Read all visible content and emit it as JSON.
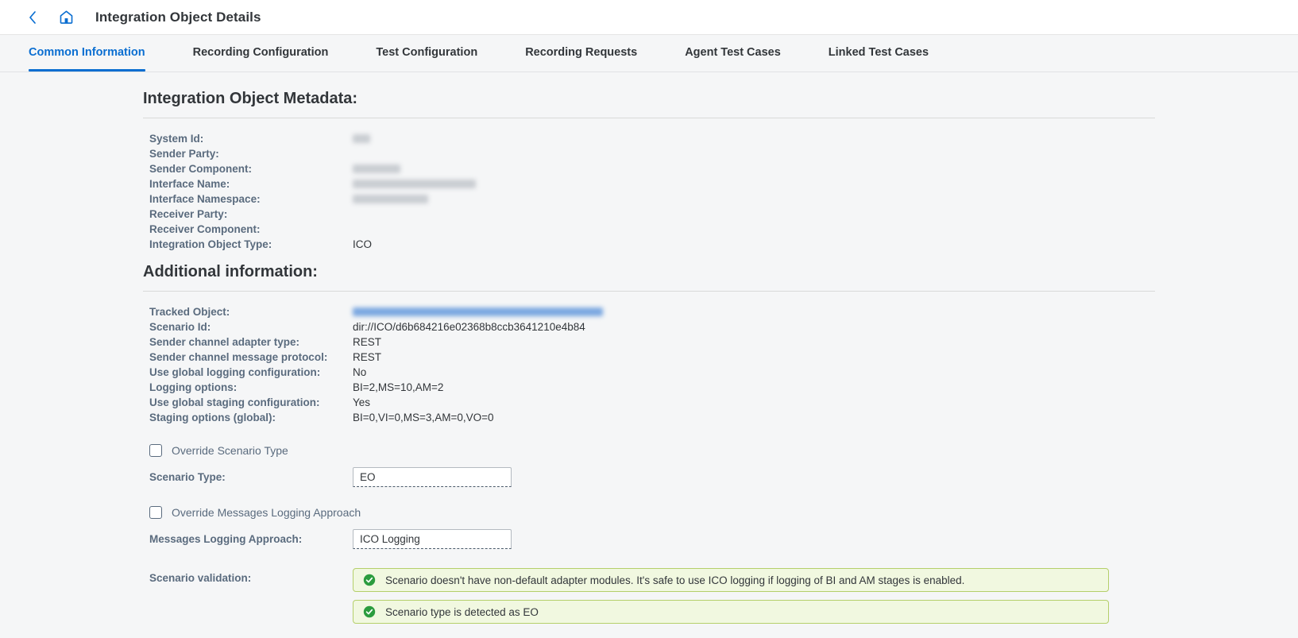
{
  "header": {
    "back_icon": "chevron-left-icon",
    "home_icon": "home-icon",
    "title": "Integration Object Details"
  },
  "tabs": [
    {
      "label": "Common Information",
      "active": true
    },
    {
      "label": "Recording Configuration",
      "active": false
    },
    {
      "label": "Test Configuration",
      "active": false
    },
    {
      "label": "Recording Requests",
      "active": false
    },
    {
      "label": "Agent Test Cases",
      "active": false
    },
    {
      "label": "Linked Test Cases",
      "active": false
    }
  ],
  "metadata": {
    "title": "Integration Object Metadata:",
    "fields": [
      {
        "label": "System Id:",
        "value": "",
        "redacted": true,
        "redact_w": 22,
        "redact_color": "gray"
      },
      {
        "label": "Sender Party:",
        "value": "",
        "redacted": false
      },
      {
        "label": "Sender Component:",
        "value": "",
        "redacted": true,
        "redact_w": 60,
        "redact_color": "gray"
      },
      {
        "label": "Interface Name:",
        "value": "",
        "redacted": true,
        "redact_w": 155,
        "redact_color": "gray"
      },
      {
        "label": "Interface Namespace:",
        "value": "",
        "redacted": true,
        "redact_w": 95,
        "redact_color": "gray"
      },
      {
        "label": "Receiver Party:",
        "value": "",
        "redacted": false
      },
      {
        "label": "Receiver Component:",
        "value": "",
        "redacted": false
      },
      {
        "label": "Integration Object Type:",
        "value": "ICO",
        "redacted": false
      }
    ]
  },
  "additional": {
    "title": "Additional information:",
    "fields": [
      {
        "label": "Tracked Object:",
        "value": "",
        "redacted": true,
        "redact_w": 315,
        "redact_color": "blue"
      },
      {
        "label": "Scenario Id:",
        "value": "dir://ICO/d6b684216e02368b8ccb3641210e4b84",
        "redacted": false
      },
      {
        "label": "Sender channel adapter type:",
        "value": "REST",
        "redacted": false
      },
      {
        "label": "Sender channel message protocol:",
        "value": "REST",
        "redacted": false
      },
      {
        "label": "Use global logging configuration:",
        "value": "No",
        "redacted": false
      },
      {
        "label": "Logging options:",
        "value": "BI=2,MS=10,AM=2",
        "redacted": false
      },
      {
        "label": "Use global staging configuration:",
        "value": "Yes",
        "redacted": false
      },
      {
        "label": "Staging options (global):",
        "value": "BI=0,VI=0,MS=3,AM=0,VO=0",
        "redacted": false
      }
    ]
  },
  "form": {
    "override_scenario_type": {
      "label": "Override Scenario Type",
      "checked": false
    },
    "scenario_type": {
      "label": "Scenario Type:",
      "value": "EO",
      "placeholder": ""
    },
    "override_logging_approach": {
      "label": "Override Messages Logging Approach",
      "checked": false
    },
    "messages_logging_approach": {
      "label": "Messages Logging Approach:",
      "value": "ICO Logging",
      "placeholder": ""
    },
    "validation_label": "Scenario validation:",
    "validation_messages": [
      {
        "status": "success",
        "icon": "check-circle-icon",
        "text": "Scenario doesn't have non-default adapter modules. It's safe to use ICO logging if logging of BI and AM stages is enabled."
      },
      {
        "status": "success",
        "icon": "check-circle-icon",
        "text": "Scenario type is detected as EO"
      }
    ]
  },
  "colors": {
    "accent": "#0a6ed1",
    "label": "#5a6b7e",
    "text": "#32363a",
    "success_bg": "#f1f8e0",
    "success_border": "#b5cf6b",
    "success_icon": "#2b9c3e",
    "page_bg": "#f5f6f7"
  }
}
